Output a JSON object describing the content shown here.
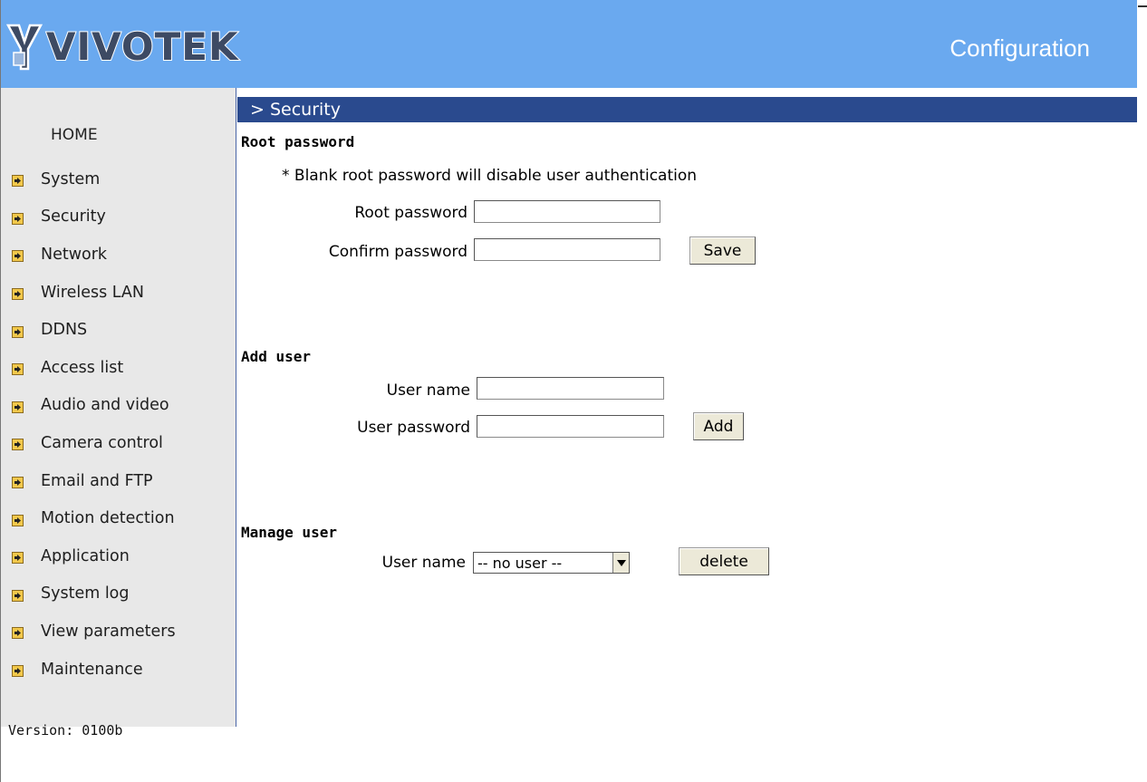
{
  "header": {
    "logo_text": "VIVOTEK",
    "title": "Configuration",
    "brand_color": "#6aa9ef"
  },
  "sidebar": {
    "home_label": "HOME",
    "items": [
      {
        "label": "System",
        "icon": "arrow-right-icon"
      },
      {
        "label": "Security",
        "icon": "arrow-right-icon"
      },
      {
        "label": "Network",
        "icon": "arrow-right-icon"
      },
      {
        "label": "Wireless LAN",
        "icon": "arrow-right-icon"
      },
      {
        "label": "DDNS",
        "icon": "arrow-right-icon"
      },
      {
        "label": "Access list",
        "icon": "arrow-right-icon"
      },
      {
        "label": "Audio and video",
        "icon": "arrow-right-icon"
      },
      {
        "label": "Camera control",
        "icon": "arrow-right-icon"
      },
      {
        "label": "Email and FTP",
        "icon": "arrow-right-icon"
      },
      {
        "label": "Motion detection",
        "icon": "arrow-right-icon"
      },
      {
        "label": "Application",
        "icon": "arrow-right-icon"
      },
      {
        "label": "System log",
        "icon": "arrow-right-icon"
      },
      {
        "label": "View parameters",
        "icon": "arrow-right-icon"
      },
      {
        "label": "Maintenance",
        "icon": "arrow-right-icon"
      }
    ],
    "version_text": "Version: 0100b"
  },
  "main": {
    "section_title": "> Security",
    "root_password": {
      "heading": "Root password",
      "note": "* Blank root password will disable user authentication",
      "root_label": "Root password",
      "root_value": "",
      "confirm_label": "Confirm password",
      "confirm_value": "",
      "save_label": "Save"
    },
    "add_user": {
      "heading": "Add user",
      "name_label": "User name",
      "name_value": "",
      "password_label": "User password",
      "password_value": "",
      "add_label": "Add"
    },
    "manage_user": {
      "heading": "Manage user",
      "name_label": "User name",
      "selected_user": "-- no user --",
      "delete_label": "delete"
    }
  },
  "colors": {
    "section_bar": "#2a4a8e",
    "sidebar_bg": "#e8e8e8",
    "button_bg": "#ece9d8"
  }
}
